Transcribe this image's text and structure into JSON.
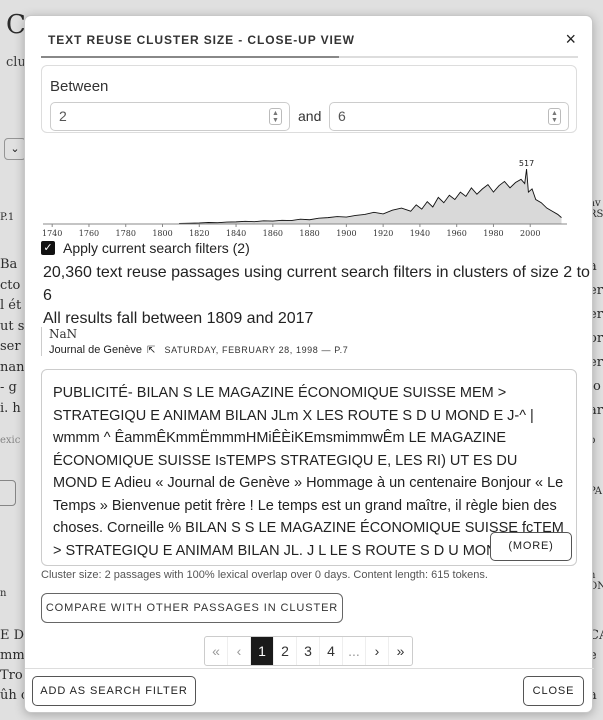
{
  "modal": {
    "title": "TEXT REUSE CLUSTER SIZE - CLOSE-UP VIEW",
    "close_glyph": "×",
    "between_label": "Between",
    "min_value": "2",
    "and_label": "and",
    "max_value": "6",
    "apply_label": "Apply current search filters (2)",
    "summary_line1": "20,360 text reuse passages using current search filters in clusters of size 2 to 6",
    "summary_line2": "All results fall between 1809 and 2017",
    "doc_title": "NaN",
    "newspaper": "Journal de Genève",
    "external_glyph": "⇱",
    "date_page": "SATURDAY, FEBRUARY 28, 1998 — P.7",
    "passage_text": "PUBLICITÉ- BILAN S LE MAGAZINE ÉCONOMIQUE SUISSE MEM > STRATEGIQU E ANIMAM BILAN JLm X LES ROUTE S D U MOND E J-^ | wmmm ^ ÊammÊKmmËmmmHMiÊÈiKEmsmimmwÊm LE MAGAZINE ÉCONOMIQUE SUISSE IsTEMPS STRATEGIQU E, LES RI) UT ES DU MOND E Adieu « Journal de Genève » Hommage à un centenaire Bonjour « Le Temps » Bienvenue petit frère ! Le temps est un grand maître, il règle bien des choses. Corneille % BILAN S S LE MAGAZINE ÉCONOMIQUE SUISSE fcTEM > STRATEGIQU E ANIMAM BILAN JL. J L LE S ROUTE S D U MOND",
    "more_label": "(MORE)",
    "cluster_info": "Cluster size: 2 passages with 100% lexical overlap over 0 days. Content length: 615 tokens.",
    "compare_label": "COMPARE WITH OTHER PASSAGES IN CLUSTER",
    "pagination": [
      "«",
      "‹",
      "1",
      "2",
      "3",
      "4",
      "...",
      "›",
      "»"
    ],
    "active_page": "1",
    "add_filter_label": "ADD AS SEARCH FILTER",
    "close_label": "CLOSE"
  },
  "background": {
    "title_fragment": "C",
    "subtitle_fragment": "clus",
    "select_glyph": "⌄"
  },
  "colors": {
    "accent": "#1a1a1a",
    "histogram_fill": "#d9d9d9",
    "histogram_line": "#111111"
  },
  "chart_data": {
    "type": "area",
    "title": "",
    "xlabel": "",
    "ylabel": "",
    "xlim": [
      1735,
      2020
    ],
    "peak_label": "517",
    "x_ticks": [
      "1740",
      "1760",
      "1780",
      "1800",
      "1820",
      "1840",
      "1860",
      "1880",
      "1900",
      "1920",
      "1940",
      "1960",
      "1980",
      "2000"
    ],
    "x": [
      1809,
      1815,
      1820,
      1825,
      1830,
      1835,
      1840,
      1845,
      1850,
      1855,
      1860,
      1865,
      1870,
      1875,
      1880,
      1885,
      1890,
      1895,
      1900,
      1905,
      1910,
      1915,
      1920,
      1925,
      1930,
      1935,
      1938,
      1941,
      1944,
      1947,
      1950,
      1953,
      1956,
      1959,
      1962,
      1965,
      1968,
      1971,
      1974,
      1977,
      1980,
      1983,
      1986,
      1989,
      1992,
      1995,
      1997,
      1998,
      1999,
      2001,
      2003,
      2006,
      2009,
      2012,
      2015,
      2017
    ],
    "values": [
      5,
      8,
      10,
      14,
      12,
      18,
      20,
      25,
      22,
      30,
      28,
      35,
      32,
      45,
      40,
      55,
      60,
      70,
      65,
      80,
      90,
      110,
      95,
      130,
      150,
      120,
      180,
      140,
      210,
      160,
      250,
      200,
      270,
      230,
      300,
      260,
      340,
      280,
      330,
      370,
      300,
      360,
      400,
      340,
      390,
      420,
      380,
      517,
      300,
      330,
      230,
      200,
      150,
      120,
      90,
      60
    ]
  }
}
